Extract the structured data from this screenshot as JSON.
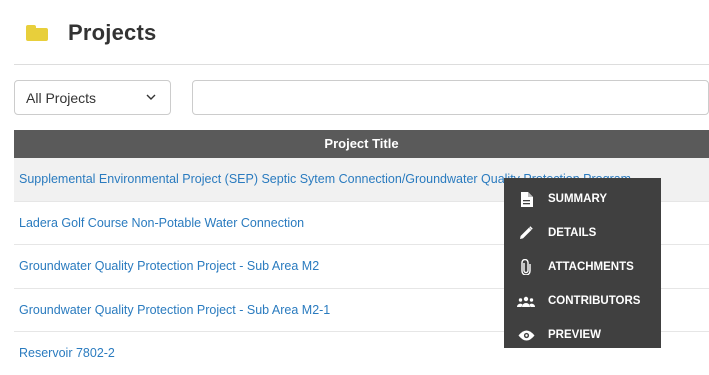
{
  "header": {
    "title": "Projects",
    "icon": "folder-icon",
    "icon_color": "#e8cf3b"
  },
  "filter": {
    "selected": "All Projects",
    "search_value": ""
  },
  "table": {
    "column_header": "Project Title",
    "rows": [
      "Supplemental Environmental Project (SEP) Septic Sytem Connection/Groundwater Quality Protection Program",
      "Ladera Golf Course Non-Potable Water Connection",
      "Groundwater Quality Protection Project - Sub Area M2",
      "Groundwater Quality Protection Project - Sub Area M2-1",
      "Reservoir 7802-2"
    ]
  },
  "context_menu": {
    "items": [
      {
        "label": "SUMMARY",
        "icon": "document-icon"
      },
      {
        "label": "DETAILS",
        "icon": "pencil-icon"
      },
      {
        "label": "ATTACHMENTS",
        "icon": "paperclip-icon"
      },
      {
        "label": "CONTRIBUTORS",
        "icon": "people-icon"
      },
      {
        "label": "PREVIEW",
        "icon": "eye-icon"
      }
    ]
  },
  "colors": {
    "link": "#2a7bbf",
    "header_bg": "#5a5a5a",
    "menu_bg": "#404040"
  }
}
